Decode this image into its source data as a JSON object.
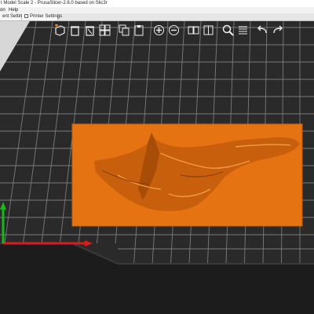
{
  "window": {
    "title": "t Model Scale 2 - PrusaSlicer-2.6.0 based on Slic3r"
  },
  "menu": {
    "items": [
      "on",
      "Help"
    ]
  },
  "tabs": [
    {
      "label": "ent Settings"
    },
    {
      "label": "Printer Settings"
    }
  ],
  "toolbar": {
    "tools": [
      {
        "icon": "add-icon"
      },
      {
        "icon": "delete-icon"
      },
      {
        "icon": "delete-all-icon"
      },
      {
        "icon": "arrange-icon"
      },
      {
        "icon": "copy-icon"
      },
      {
        "icon": "paste-icon"
      },
      {
        "icon": "add-instance-icon"
      },
      {
        "icon": "remove-instance-icon"
      },
      {
        "icon": "split-objects-icon"
      },
      {
        "icon": "split-parts-icon"
      },
      {
        "icon": "search-icon"
      },
      {
        "icon": "layers-editing-icon"
      },
      {
        "icon": "undo-icon"
      },
      {
        "icon": "redo-icon"
      }
    ]
  },
  "scene": {
    "bed_color": "#2a2a2a",
    "grid_color": "#8a8a8a",
    "object_color": "#e8781a",
    "x_axis_color": "#e01818",
    "y_axis_color": "#18b818"
  }
}
